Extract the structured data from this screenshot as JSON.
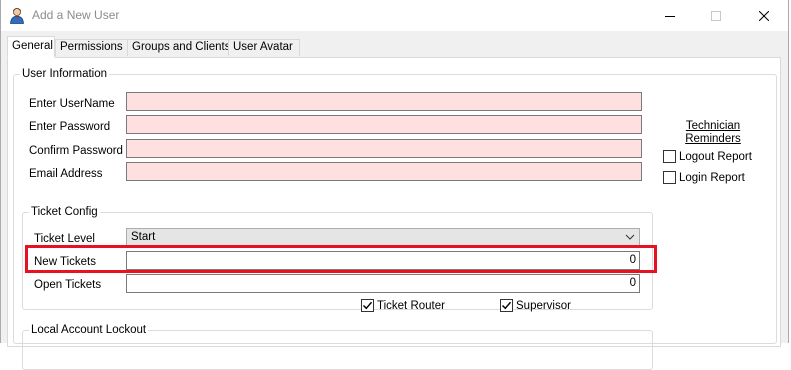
{
  "window": {
    "title": "Add a New User",
    "colors": {
      "accent_highlight": "#e81123",
      "required_field": "#ffe0e0"
    }
  },
  "tabs": [
    {
      "label": "General",
      "active": true
    },
    {
      "label": "Permissions",
      "active": false
    },
    {
      "label": "Groups and Clients",
      "active": false
    },
    {
      "label": "User Avatar",
      "active": false
    }
  ],
  "user_info": {
    "legend": "User Information",
    "fields": [
      {
        "label": "Enter UserName",
        "value": ""
      },
      {
        "label": "Enter Password",
        "value": ""
      },
      {
        "label": "Confirm Password",
        "value": ""
      },
      {
        "label": "Email Address",
        "value": ""
      }
    ],
    "tech_reminders_title": "Technician Reminders",
    "logout_report": {
      "label": "Logout Report",
      "checked": false
    },
    "login_report": {
      "label": "Login Report",
      "checked": false
    }
  },
  "ticket_config": {
    "legend": "Ticket Config",
    "ticket_level": {
      "label": "Ticket Level",
      "value": "Start"
    },
    "new_tickets": {
      "label": "New Tickets",
      "value": "0"
    },
    "open_tickets": {
      "label": "Open Tickets",
      "value": "0"
    },
    "ticket_router": {
      "label": "Ticket Router",
      "checked": true
    },
    "supervisor": {
      "label": "Supervisor",
      "checked": true
    }
  },
  "lockout": {
    "legend": "Local Account Lockout"
  }
}
